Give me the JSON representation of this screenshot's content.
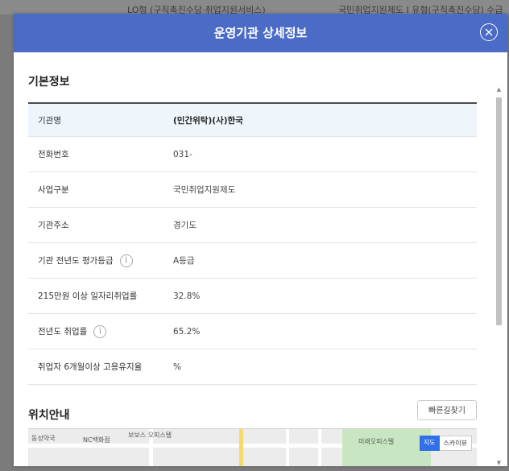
{
  "background": {
    "left_text": "LO형 (구직촉진수당·취업지원서비스)",
    "right_text": "국민취업지원제도 I 유형(구직촉진수당) 수급"
  },
  "modal": {
    "title": "운영기관 상세정보",
    "header_color": "#4a6bc6"
  },
  "basic_info": {
    "section_title": "기본정보",
    "rows": [
      {
        "label": "기관명",
        "value": "(민간위탁)(사)한국"
      },
      {
        "label": "전화번호",
        "value": "031-"
      },
      {
        "label": "사업구분",
        "value": "국민취업지원제도"
      },
      {
        "label": "기관주소",
        "value": "경기도"
      },
      {
        "label": "기관 전년도 평가등급",
        "value": "A등급"
      },
      {
        "label": "215만원 이상 일자리취업률",
        "value": "32.8%"
      },
      {
        "label": "전년도 취업률",
        "value": "65.2%"
      },
      {
        "label": "취업자 6개월이상 고용유지율",
        "value": "%"
      }
    ]
  },
  "location": {
    "section_title": "위치안내",
    "route_button": "빠른길찾기",
    "map_labels": [
      "동성약국",
      "NC백화점",
      "보보스 오피스텔",
      "미래오피스텔"
    ],
    "map_toggle": {
      "map": "지도",
      "sky": "스카이뷰"
    }
  }
}
